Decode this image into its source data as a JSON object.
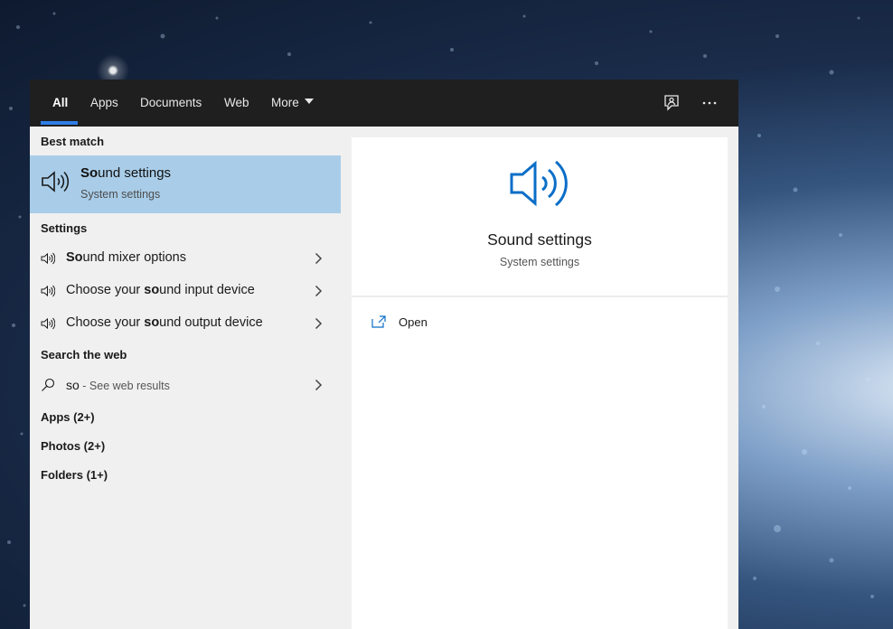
{
  "tabs": [
    {
      "label": "All"
    },
    {
      "label": "Apps"
    },
    {
      "label": "Documents"
    },
    {
      "label": "Web"
    },
    {
      "label": "More"
    }
  ],
  "top_icons": [
    "feedback-icon",
    "more-options-icon"
  ],
  "best_match": {
    "header": "Best match",
    "title_bold": "So",
    "title_rest": "und settings",
    "subtitle": "System settings",
    "icon": "speaker-icon"
  },
  "settings": {
    "header": "Settings",
    "items": [
      {
        "prefix": "",
        "bold": "So",
        "rest": "und mixer options"
      },
      {
        "prefix": "Choose your ",
        "bold": "so",
        "rest": "und input device"
      },
      {
        "prefix": "Choose your ",
        "bold": "so",
        "rest": "und output device"
      }
    ]
  },
  "web": {
    "header": "Search the web",
    "query": "so",
    "hint": " - See web results"
  },
  "categories": [
    {
      "label": "Apps (2+)"
    },
    {
      "label": "Photos (2+)"
    },
    {
      "label": "Folders (1+)"
    }
  ],
  "preview": {
    "title": "Sound settings",
    "subtitle": "System settings",
    "action_open": "Open"
  },
  "colors": {
    "accent": "#2f7ee6",
    "selection": "#a9cde9",
    "icon_blue": "#0a6ec7",
    "topbar": "#1f1f1f"
  }
}
